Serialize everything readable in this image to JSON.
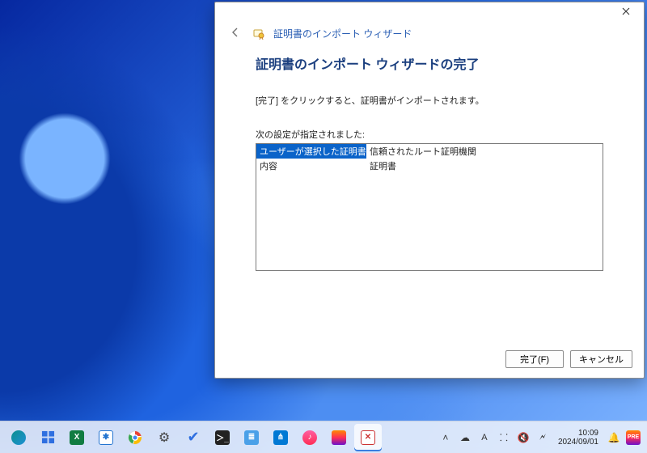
{
  "dialog": {
    "breadcrumb": "証明書のインポート ウィザード",
    "title": "証明書のインポート ウィザードの完了",
    "instruction": "[完了] をクリックすると、証明書がインポートされます。",
    "settings_label": "次の設定が指定されました:",
    "rows": [
      {
        "k": "ユーザーが選択した証明書ストア",
        "v": "信頼されたルート証明機関"
      },
      {
        "k": "内容",
        "v": "証明書"
      }
    ],
    "finish": "完了(F)",
    "cancel": "キャンセル"
  },
  "tray": {
    "time": "10:09",
    "date": "2024/09/01"
  }
}
